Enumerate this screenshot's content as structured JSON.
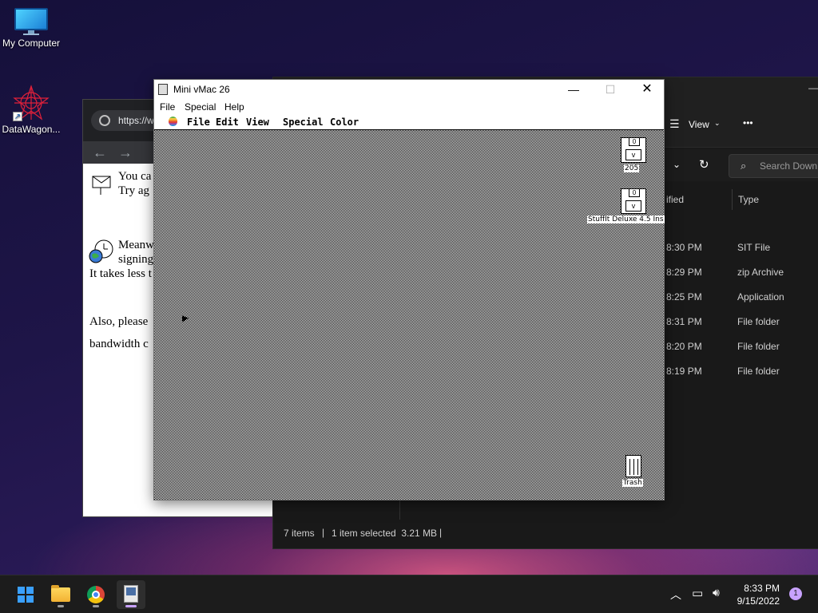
{
  "desktop": {
    "icons": [
      {
        "label": "My Computer",
        "icon": "monitor-icon"
      },
      {
        "label": "DataWagon...",
        "icon": "datawagon-star-icon"
      }
    ]
  },
  "browser": {
    "url": "https://w",
    "lines": [
      "You ca",
      "Try ag",
      "Meanw",
      "signing",
      "It takes less t",
      "Also, please",
      "bandwidth c"
    ]
  },
  "explorer": {
    "view_label": "View",
    "more_label": "•••",
    "search_placeholder": "Search Down",
    "col_modified": "ified",
    "col_type": "Type",
    "rows": [
      {
        "time": "8:30 PM",
        "type": "SIT File"
      },
      {
        "time": "8:29 PM",
        "type": "zip Archive"
      },
      {
        "time": "8:25 PM",
        "type": "Application"
      },
      {
        "time": "8:31 PM",
        "type": "File folder"
      },
      {
        "time": "8:20 PM",
        "type": "File folder"
      },
      {
        "time": "8:19 PM",
        "type": "File folder"
      }
    ],
    "status_items": "7 items",
    "status_selected": "1 item selected  3.21 MB"
  },
  "vmac": {
    "title": "Mini vMac 26",
    "host_menu": [
      "File",
      "Special",
      "Help"
    ],
    "mac_menu": [
      "File",
      "Edit",
      "View",
      "Special",
      "Color"
    ],
    "disk1_name": "205",
    "disk2_name": "StuffIt Deluxe 4.5 Ins",
    "disk_shutter": "0",
    "disk_label": "v",
    "trash_label": "Trash"
  },
  "taskbar": {
    "time": "8:33 PM",
    "date": "9/15/2022",
    "notification_count": "1"
  },
  "colors": {
    "accent": "#c8a2ff",
    "explorer_bg": "#191919",
    "taskbar_bg": "#1c1c1c"
  }
}
